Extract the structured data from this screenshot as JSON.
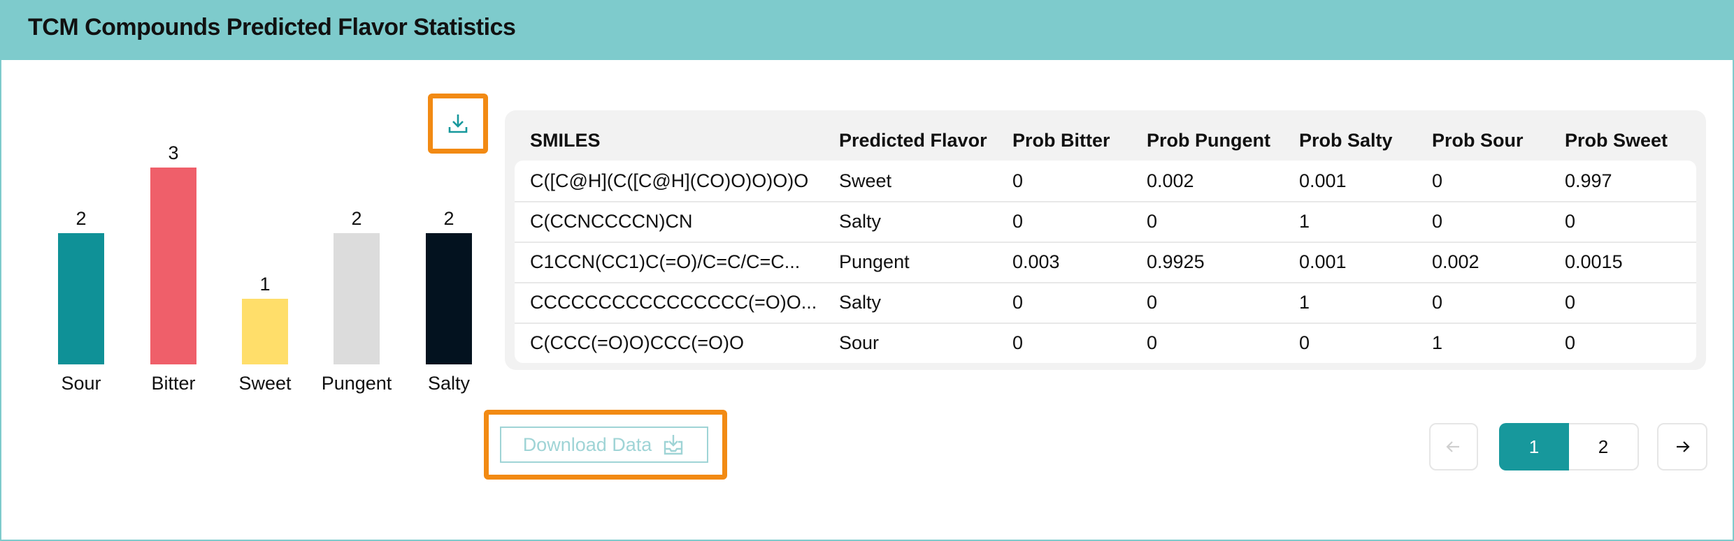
{
  "header": {
    "title": "TCM Compounds Predicted Flavor Statistics"
  },
  "chart_data": {
    "type": "bar",
    "categories": [
      "Sour",
      "Bitter",
      "Sweet",
      "Pungent",
      "Salty"
    ],
    "values": [
      2,
      3,
      1,
      2,
      2
    ],
    "value_labels": [
      "2",
      "3",
      "1",
      "2",
      "2"
    ],
    "colors": [
      "#0f9197",
      "#ef5f6a",
      "#ffde6a",
      "#dcdcdc",
      "#03121f"
    ],
    "ylim": [
      0,
      3
    ],
    "legend": "none",
    "grid": false
  },
  "table": {
    "columns": [
      "SMILES",
      "Predicted Flavor",
      "Prob Bitter",
      "Prob Pungent",
      "Prob Salty",
      "Prob Sour",
      "Prob Sweet"
    ],
    "rows": [
      [
        "C([C@H](C([C@H](CO)O)O)O)O",
        "Sweet",
        "0",
        "0.002",
        "0.001",
        "0",
        "0.997"
      ],
      [
        "C(CCNCCCCN)CN",
        "Salty",
        "0",
        "0",
        "1",
        "0",
        "0"
      ],
      [
        "C1CCN(CC1)C(=O)/C=C/C=C...",
        "Pungent",
        "0.003",
        "0.9925",
        "0.001",
        "0.002",
        "0.0015"
      ],
      [
        "CCCCCCCCCCCCCCCC(=O)O...",
        "Salty",
        "0",
        "0",
        "1",
        "0",
        "0"
      ],
      [
        "C(CCC(=O)O)CCC(=O)O",
        "Sour",
        "0",
        "0",
        "0",
        "1",
        "0"
      ]
    ]
  },
  "actions": {
    "download_icon": "download-icon",
    "download_data_label": "Download Data"
  },
  "pagination": {
    "prev_icon": "arrow-left-icon",
    "pages": [
      "1",
      "2"
    ],
    "current_page": "1",
    "next_icon": "arrow-right-icon"
  },
  "colors": {
    "accent": "#17989c",
    "header_bg": "#7ecbcc",
    "highlight": "#f28a13"
  }
}
